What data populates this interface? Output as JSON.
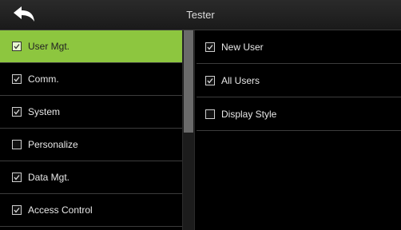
{
  "header": {
    "title": "Tester",
    "back_icon": "back-arrow-icon"
  },
  "menu": {
    "items": [
      {
        "label": "User Mgt.",
        "checked": true,
        "selected": true
      },
      {
        "label": "Comm.",
        "checked": true,
        "selected": false
      },
      {
        "label": "System",
        "checked": true,
        "selected": false
      },
      {
        "label": "Personalize",
        "checked": false,
        "selected": false
      },
      {
        "label": "Data Mgt.",
        "checked": true,
        "selected": false
      },
      {
        "label": "Access Control",
        "checked": true,
        "selected": false
      }
    ]
  },
  "submenu": {
    "items": [
      {
        "label": "New User",
        "checked": true
      },
      {
        "label": "All Users",
        "checked": true
      },
      {
        "label": "Display Style",
        "checked": false
      }
    ]
  },
  "colors": {
    "selected_bg": "#8dc63f",
    "background": "#000000",
    "divider": "#3c3c3c"
  }
}
